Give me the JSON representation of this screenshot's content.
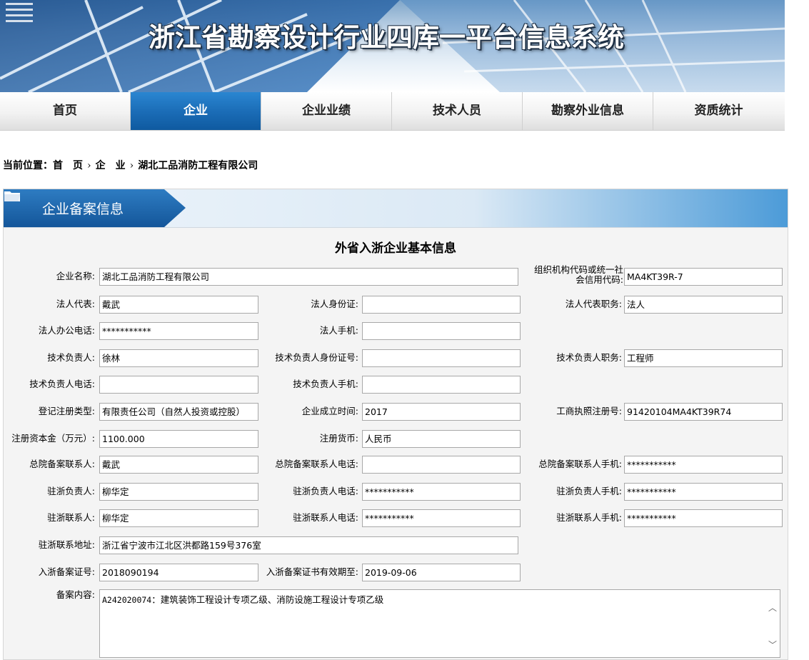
{
  "header": {
    "title": "浙江省勘察设计行业四库一平台信息系统"
  },
  "nav": {
    "items": [
      "首页",
      "企业",
      "企业业绩",
      "技术人员",
      "勘察外业信息",
      "资质统计"
    ],
    "active_index": 1
  },
  "breadcrumb": {
    "label": "当前位置：",
    "items": [
      "首　页",
      "企　业",
      "湖北工品消防工程有限公司"
    ],
    "sep": "›"
  },
  "panel": {
    "title": "企业备案信息",
    "form_title": "外省入浙企业基本信息"
  },
  "fields": {
    "company_name": {
      "label": "企业名称:",
      "value": "湖北工品消防工程有限公司"
    },
    "org_code": {
      "label": "组织机构代码或统一社会信用代码:",
      "value": "MA4KT39R-7"
    },
    "legal_rep": {
      "label": "法人代表:",
      "value": "戴武"
    },
    "legal_id": {
      "label": "法人身份证:",
      "value": ""
    },
    "legal_title": {
      "label": "法人代表职务:",
      "value": "法人"
    },
    "legal_phone": {
      "label": "法人办公电话:",
      "value": "***********"
    },
    "legal_mobile": {
      "label": "法人手机:",
      "value": ""
    },
    "tech_lead": {
      "label": "技术负责人:",
      "value": "徐林"
    },
    "tech_id": {
      "label": "技术负责人身份证号:",
      "value": ""
    },
    "tech_title": {
      "label": "技术负责人职务:",
      "value": "工程师"
    },
    "tech_phone": {
      "label": "技术负责人电话:",
      "value": ""
    },
    "tech_mobile": {
      "label": "技术负责人手机:",
      "value": ""
    },
    "reg_type": {
      "label": "登记注册类型:",
      "value": "有限责任公司（自然人投资或控股）"
    },
    "founded": {
      "label": "企业成立时间:",
      "value": "2017"
    },
    "biz_license": {
      "label": "工商执照注册号:",
      "value": "91420104MA4KT39R74"
    },
    "reg_capital": {
      "label": "注册资本金（万元）:",
      "value": "1100.000"
    },
    "currency": {
      "label": "注册货币:",
      "value": "人民币"
    },
    "hq_contact": {
      "label": "总院备案联系人:",
      "value": "戴武"
    },
    "hq_contact_phone": {
      "label": "总院备案联系人电话:",
      "value": ""
    },
    "hq_contact_mobile": {
      "label": "总院备案联系人手机:",
      "value": "***********"
    },
    "zj_lead": {
      "label": "驻浙负责人:",
      "value": "柳华定"
    },
    "zj_lead_phone": {
      "label": "驻浙负责人电话:",
      "value": "***********"
    },
    "zj_lead_mobile": {
      "label": "驻浙负责人手机:",
      "value": "***********"
    },
    "zj_contact": {
      "label": "驻浙联系人:",
      "value": "柳华定"
    },
    "zj_contact_phone": {
      "label": "驻浙联系人电话:",
      "value": "***********"
    },
    "zj_contact_mobile": {
      "label": "驻浙联系人手机:",
      "value": "***********"
    },
    "zj_address": {
      "label": "驻浙联系地址:",
      "value": "浙江省宁波市江北区洪都路159号376室"
    },
    "record_no": {
      "label": "入浙备案证号:",
      "value": "2018090194"
    },
    "record_valid": {
      "label": "入浙备案证书有效期至:",
      "value": "2019-09-06"
    },
    "record_content": {
      "label": "备案内容:",
      "code": "A242020074",
      "value": "：建筑装饰工程设计专项乙级、消防设施工程设计专项乙级"
    }
  }
}
